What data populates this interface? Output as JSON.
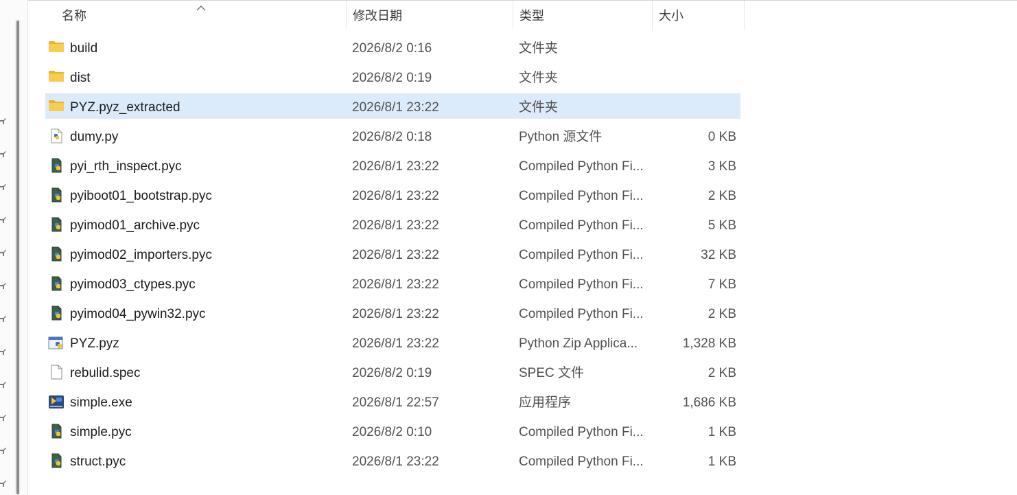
{
  "columns": {
    "name": "名称",
    "modified": "修改日期",
    "type": "类型",
    "size": "大小"
  },
  "colors": {
    "selected_row": "#dcebfc",
    "folder": "#f8cd4f"
  },
  "files": [
    {
      "name": "build",
      "modified": "2026/8/2 0:16",
      "type": "文件夹",
      "size": "",
      "icon": "folder-icon"
    },
    {
      "name": "dist",
      "modified": "2026/8/2 0:19",
      "type": "文件夹",
      "size": "",
      "icon": "folder-icon"
    },
    {
      "name": "PYZ.pyz_extracted",
      "modified": "2026/8/1 23:22",
      "type": "文件夹",
      "size": "",
      "icon": "folder-icon",
      "selected": true
    },
    {
      "name": "dumy.py",
      "modified": "2026/8/2 0:18",
      "type": "Python 源文件",
      "size": "0 KB",
      "icon": "python-source-icon"
    },
    {
      "name": "pyi_rth_inspect.pyc",
      "modified": "2026/8/1 23:22",
      "type": "Compiled Python Fi...",
      "size": "3 KB",
      "icon": "compiled-python-icon"
    },
    {
      "name": "pyiboot01_bootstrap.pyc",
      "modified": "2026/8/1 23:22",
      "type": "Compiled Python Fi...",
      "size": "2 KB",
      "icon": "compiled-python-icon"
    },
    {
      "name": "pyimod01_archive.pyc",
      "modified": "2026/8/1 23:22",
      "type": "Compiled Python Fi...",
      "size": "5 KB",
      "icon": "compiled-python-icon"
    },
    {
      "name": "pyimod02_importers.pyc",
      "modified": "2026/8/1 23:22",
      "type": "Compiled Python Fi...",
      "size": "32 KB",
      "icon": "compiled-python-icon"
    },
    {
      "name": "pyimod03_ctypes.pyc",
      "modified": "2026/8/1 23:22",
      "type": "Compiled Python Fi...",
      "size": "7 KB",
      "icon": "compiled-python-icon"
    },
    {
      "name": "pyimod04_pywin32.pyc",
      "modified": "2026/8/1 23:22",
      "type": "Compiled Python Fi...",
      "size": "2 KB",
      "icon": "compiled-python-icon"
    },
    {
      "name": "PYZ.pyz",
      "modified": "2026/8/1 23:22",
      "type": "Python Zip Applica...",
      "size": "1,328 KB",
      "icon": "python-zip-icon"
    },
    {
      "name": "rebulid.spec",
      "modified": "2026/8/2 0:19",
      "type": "SPEC 文件",
      "size": "2 KB",
      "icon": "blank-file-icon"
    },
    {
      "name": "simple.exe",
      "modified": "2026/8/1 22:57",
      "type": "应用程序",
      "size": "1,686 KB",
      "icon": "exe-icon"
    },
    {
      "name": "simple.pyc",
      "modified": "2026/8/2 0:10",
      "type": "Compiled Python Fi...",
      "size": "1 KB",
      "icon": "compiled-python-icon"
    },
    {
      "name": "struct.pyc",
      "modified": "2026/8/1 23:22",
      "type": "Compiled Python Fi...",
      "size": "1 KB",
      "icon": "compiled-python-icon"
    }
  ]
}
